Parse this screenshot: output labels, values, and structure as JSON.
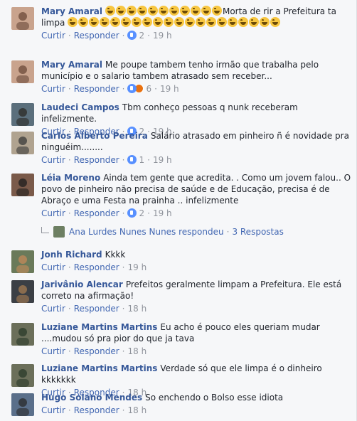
{
  "labels": {
    "like": "Curtir",
    "reply": "Responder",
    "dot": "·"
  },
  "comments": [
    {
      "name": "Mary Amaral",
      "text_before": "",
      "emoji_count_1": 11,
      "text_after": "Morta de rir a Prefeitura ta limpa",
      "emoji_count_2": 20,
      "likes": "2",
      "time": "19 h",
      "reaction": "like"
    },
    {
      "name": "Mary Amaral",
      "text": "Me poupe tambem tenho irmão que trabalha pelo município e o salario tambem atrasado sem receber...",
      "likes": "6",
      "time": "19 h",
      "reaction": "like-angry"
    },
    {
      "name": "Laudeci Campos",
      "text": "Tbm conheço pessoas q nunk receberam infelizmente.",
      "likes": "2",
      "time": "19 h",
      "reaction": "like"
    },
    {
      "name": "Carlos Alberto Pereira",
      "text": "Salário atrasado em pinheiro ñ é novidade pra ninguéim........",
      "likes": "1",
      "time": "19 h",
      "reaction": "like"
    },
    {
      "name": "Léia Moreno",
      "text": "Ainda tem gente que acredita. . Como um jovem falou.. O povo de pinheiro não precisa de saúde e de Educação, precisa é de Abraço e uma Festa na prainha .. infelizmente",
      "likes": "2",
      "time": "19 h",
      "reaction": "like"
    },
    {
      "name": "Jonh Richard",
      "text": "Kkkk",
      "likes": "",
      "time": "19 h",
      "reaction": "none"
    },
    {
      "name": "Jarivânio Alencar",
      "text": "Prefeitos geralmente limpam a Prefeitura. Ele está correto na afirmação!",
      "likes": "",
      "time": "18 h",
      "reaction": "none"
    },
    {
      "name": "Luziane Martins Martins",
      "text": "Eu acho é pouco eles queriam mudar ....mudou só pra pior do que ja tava",
      "likes": "",
      "time": "18 h",
      "reaction": "none"
    },
    {
      "name": "Luziane Martins Martins",
      "text": "Verdade só que ele limpa é o dinheiro kkkkkkk",
      "likes": "",
      "time": "18 h",
      "reaction": "none"
    },
    {
      "name": "Hugo Solano Mendes",
      "text": "So enchendo o Bolso esse idiota",
      "likes": "",
      "time": "18 h",
      "reaction": "none"
    }
  ],
  "replies": {
    "text": "Ana Lurdes Nunes Nunes respondeu",
    "count": "3 Respostas"
  },
  "icons": {
    "like": "like-icon",
    "angry": "angry-icon",
    "laugh": "laughing-emoji-icon",
    "reply_arrow": "reply-arrow-icon"
  },
  "colors": {
    "link": "#365899",
    "action": "#4267b2",
    "meta": "#90949c",
    "background": "#f6f7f9"
  }
}
